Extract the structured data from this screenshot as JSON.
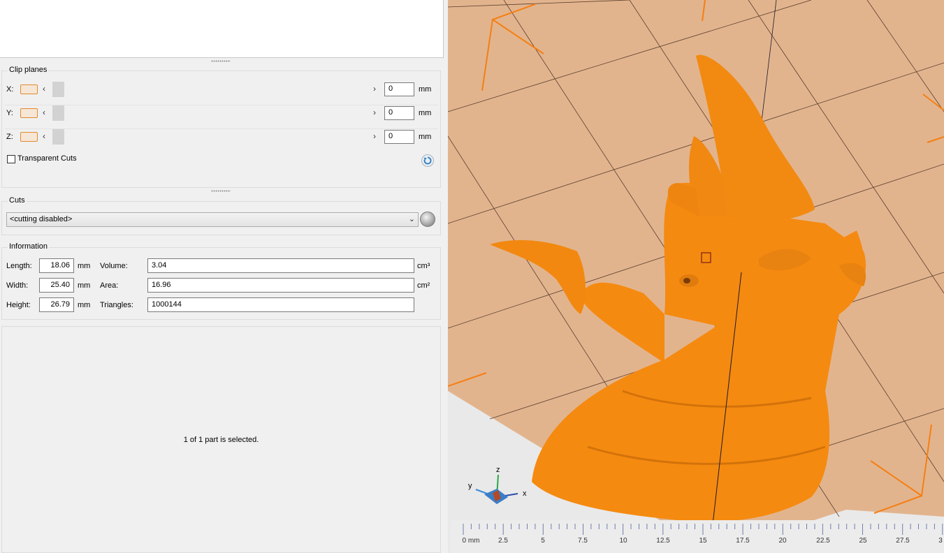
{
  "clip_planes": {
    "title": "Clip planes",
    "rows": [
      {
        "axis": "X:",
        "value": "0",
        "unit": "mm"
      },
      {
        "axis": "Y:",
        "value": "0",
        "unit": "mm"
      },
      {
        "axis": "Z:",
        "value": "0",
        "unit": "mm"
      }
    ],
    "transparent_cuts_label": "Transparent Cuts",
    "transparent_cuts_checked": false
  },
  "cuts": {
    "title": "Cuts",
    "selected": "<cutting disabled>"
  },
  "information": {
    "title": "Information",
    "length_label": "Length:",
    "length_value": "18.06",
    "length_unit": "mm",
    "width_label": "Width:",
    "width_value": "25.40",
    "width_unit": "mm",
    "height_label": "Height:",
    "height_value": "26.79",
    "height_unit": "mm",
    "volume_label": "Volume:",
    "volume_value": "3.04",
    "volume_unit": "cm³",
    "area_label": "Area:",
    "area_value": "16.96",
    "area_unit": "cm²",
    "triangles_label": "Triangles:",
    "triangles_value": "1000144"
  },
  "status": {
    "selection_text": "1 of 1 part is selected."
  },
  "viewport": {
    "axis_labels": {
      "x": "x",
      "y": "y",
      "z": "z"
    },
    "ruler": [
      "0 mm",
      "2.5",
      "5",
      "7.5",
      "10",
      "12.5",
      "15",
      "17.5",
      "20",
      "22.5",
      "25",
      "27.5",
      "3"
    ],
    "colors": {
      "model": "#f58a10",
      "plate": "#e2b48e",
      "grid": "#5a3e2e",
      "corner": "#f57f12"
    }
  }
}
